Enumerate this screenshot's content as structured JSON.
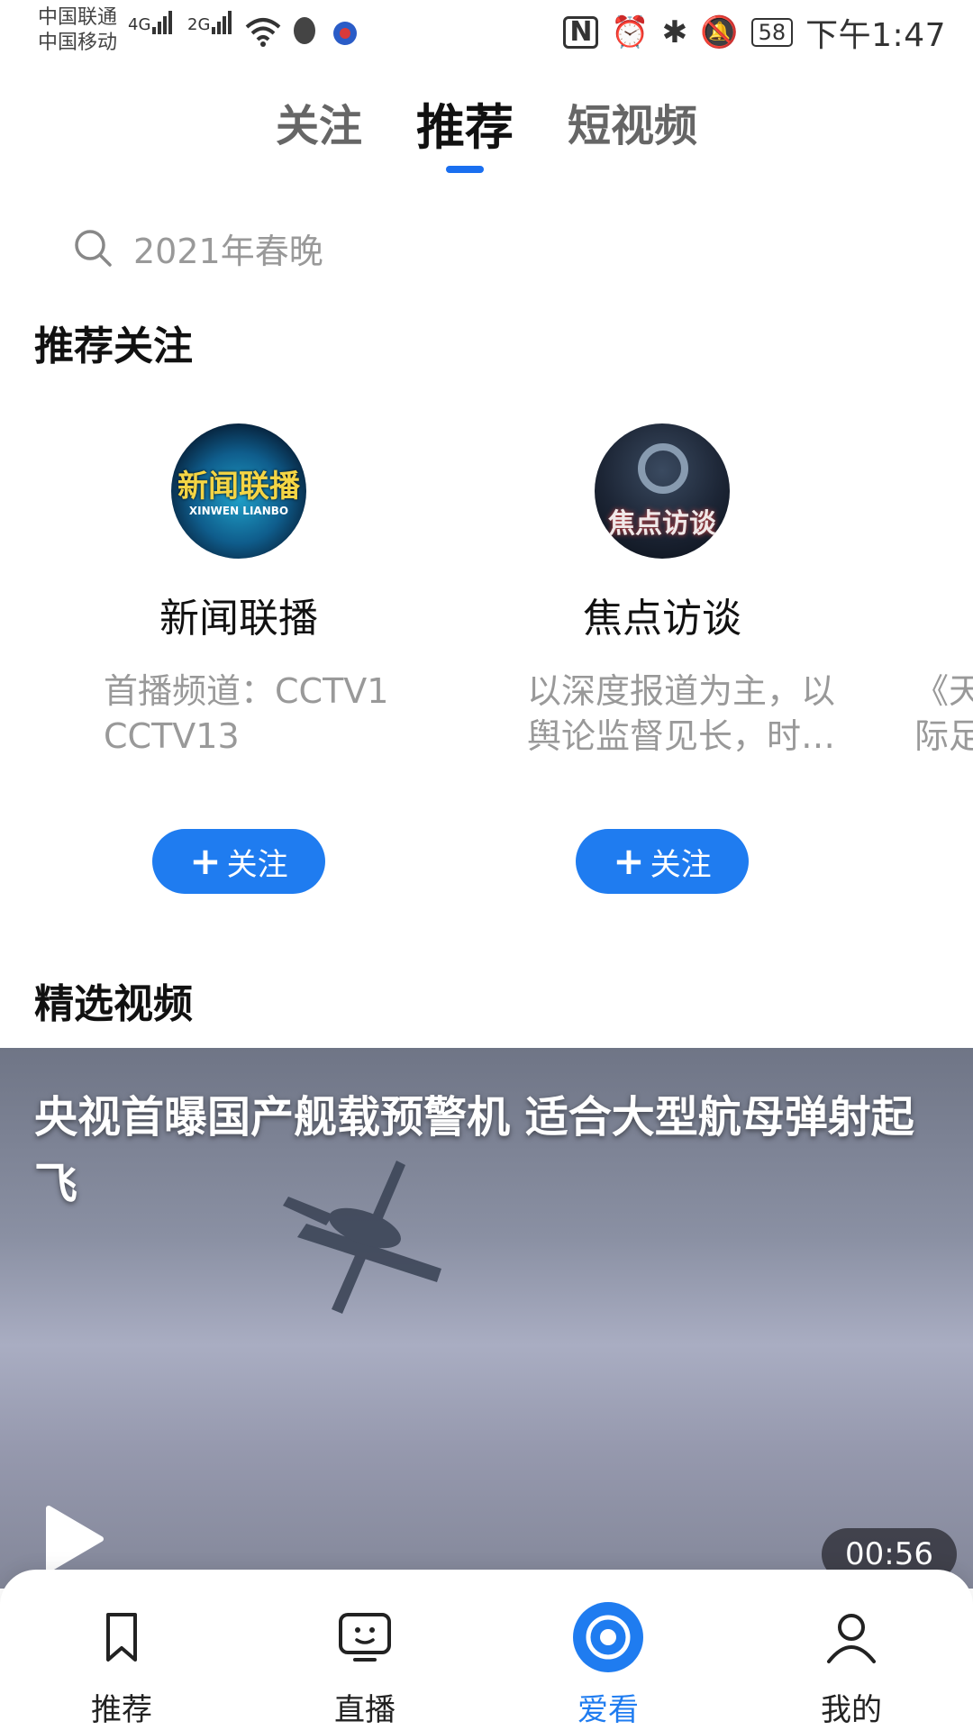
{
  "status_bar": {
    "carrier1": "中国联通",
    "carrier2": "中国移动",
    "net1": "4G",
    "net2": "2G",
    "battery": "58",
    "time": "下午1:47"
  },
  "top_tabs": [
    {
      "label": "关注",
      "active": false
    },
    {
      "label": "推荐",
      "active": true
    },
    {
      "label": "短视频",
      "active": false
    }
  ],
  "search": {
    "placeholder": "2021年春晚"
  },
  "recommend_section": {
    "title": "推荐关注",
    "cards": [
      {
        "name": "新闻联播",
        "logo_text": "新闻联播",
        "logo_sub": "XINWEN LIANBO",
        "desc": "首播频道：CCTV1 CCTV13",
        "button": "关注"
      },
      {
        "name": "焦点访谈",
        "logo_text": "焦点访谈",
        "desc": "以深度报道为主，以舆论监督见长，时…",
        "button": "关注"
      }
    ],
    "partial_desc": "《天\n际足"
  },
  "featured_section": {
    "title": "精选视频",
    "video": {
      "title": "央视首曝国产舰载预警机 适合大型航母弹射起飞",
      "duration": "00:56"
    }
  },
  "bottom_nav": [
    {
      "label": "推荐",
      "icon": "bookmark-icon",
      "active": false
    },
    {
      "label": "直播",
      "icon": "tv-icon",
      "active": false
    },
    {
      "label": "爱看",
      "icon": "target-icon",
      "active": true
    },
    {
      "label": "我的",
      "icon": "user-icon",
      "active": false
    }
  ],
  "colors": {
    "accent": "#1f7cf0",
    "muted": "#999999"
  }
}
